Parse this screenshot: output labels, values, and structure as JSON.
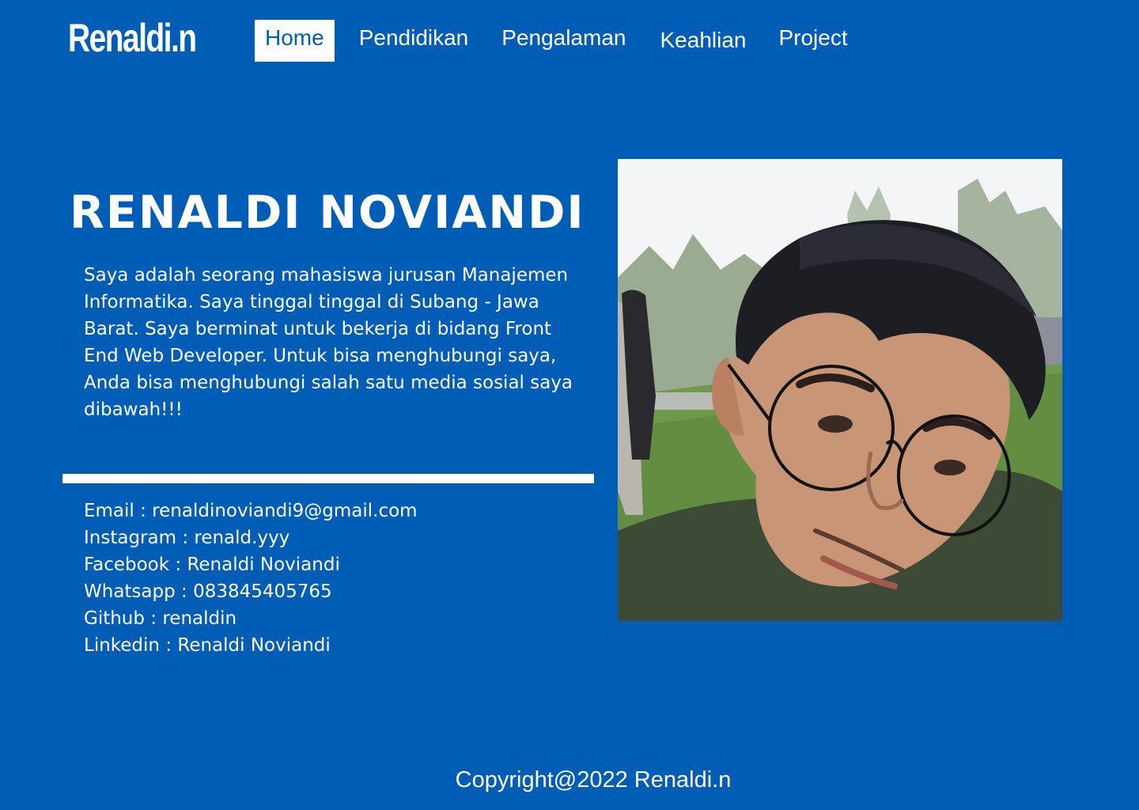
{
  "header": {
    "logo": "Renaldi.n",
    "nav": {
      "home": "Home",
      "pendidikan": "Pendidikan",
      "pengalaman": "Pengalaman",
      "keahlian": "Keahlian",
      "project": "Project"
    },
    "active_item": "Home"
  },
  "hero": {
    "name": "RENALDI NOVIANDI",
    "bio": "Saya adalah seorang mahasiswa jurusan Manajemen Informatika. Saya tinggal tinggal di Subang - Jawa Barat. Saya berminat untuk bekerja di bidang Front End Web Developer. Untuk bisa menghubungi saya, Anda bisa menghubungi salah satu media sosial saya dibawah!!!",
    "contacts": {
      "email": "Email : renaldinoviandi9@gmail.com",
      "instagram": "Instagram : renald.yyy",
      "facebook": "Facebook : Renaldi Noviandi",
      "whatsapp": "Whatsapp : 083845405765",
      "github": "Github : renaldin",
      "linkedin": "Linkedin : Renaldi Noviandi"
    }
  },
  "footer": {
    "copyright": "Copyright@2022 Renaldi.n"
  },
  "colors": {
    "background": "#005db5",
    "text": "#ffffff",
    "nav_active_bg": "#ffffff",
    "nav_active_text": "#005db5"
  }
}
